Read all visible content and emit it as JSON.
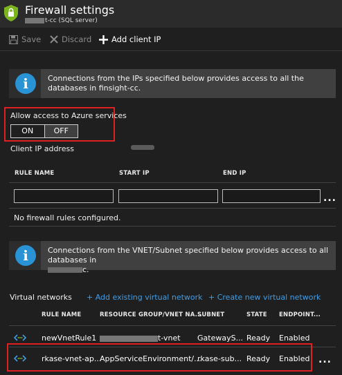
{
  "header": {
    "title": "Firewall settings",
    "subtitle_suffix": "t-cc (SQL server)"
  },
  "toolbar": {
    "save_label": "Save",
    "discard_label": "Discard",
    "add_client_ip_label": "Add client IP"
  },
  "info1": {
    "text": "Connections from the IPs specified below provides access to all the databases in finsight-cc."
  },
  "azure_access": {
    "label": "Allow access to Azure services",
    "on_label": "ON",
    "off_label": "OFF",
    "selected": "OFF"
  },
  "client_ip": {
    "label": "Client IP address"
  },
  "rules_table": {
    "columns": [
      "RULE NAME",
      "START IP",
      "END IP"
    ],
    "empty_text": "No firewall rules configured.",
    "more": "..."
  },
  "info2": {
    "text_line1": "Connections from the VNET/Subnet specified below provides access to all databases in",
    "text_line2_suffix": "c."
  },
  "vnets": {
    "label": "Virtual networks",
    "add_existing": "+ Add existing virtual network",
    "create_new": "+ Create new virtual network",
    "columns": [
      "RULE NAME",
      "RESOURCE GROUP/VNET NA...",
      "SUBNET",
      "STATE",
      "ENDPOINT..."
    ],
    "rows": [
      {
        "rule": "newVnetRule1",
        "group_suffix": "t-vnet",
        "subnet": "GatewayS...",
        "state": "Ready",
        "endpoint": "Enabled"
      },
      {
        "rule": "rkase-vnet-ap...",
        "group": "AppServiceEnvironment/...",
        "subnet": "rkase-sub...",
        "state": "Ready",
        "endpoint": "Enabled",
        "more": "..."
      }
    ]
  },
  "colors": {
    "accent_link": "#3f9ee8",
    "highlight_border": "#e02020",
    "info_icon": "#2a93d5",
    "shield": "#7ab51d"
  }
}
